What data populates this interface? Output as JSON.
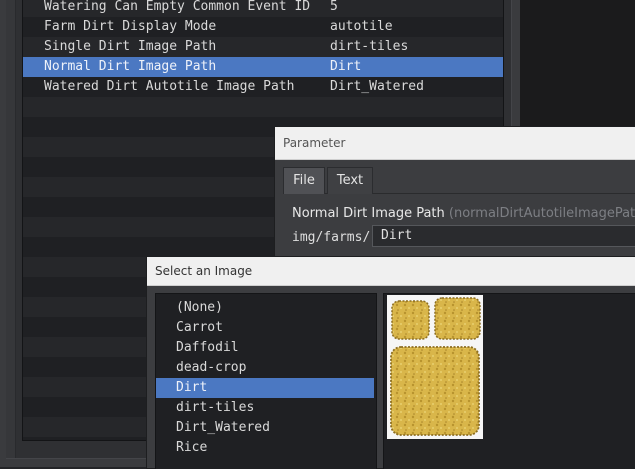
{
  "params": {
    "rows": [
      {
        "key": "Watering Can Empty Common Event ID",
        "value": "5",
        "selected": false
      },
      {
        "key": "Farm Dirt Display Mode",
        "value": "autotile",
        "selected": false
      },
      {
        "key": "Single Dirt Image Path",
        "value": "dirt-tiles",
        "selected": false
      },
      {
        "key": "Normal Dirt Image Path",
        "value": "Dirt",
        "selected": true
      },
      {
        "key": "Watered Dirt Autotile Image Path",
        "value": "Dirt_Watered",
        "selected": false
      }
    ]
  },
  "param_dialog": {
    "title": "Parameter",
    "tabs": [
      "File",
      "Text"
    ],
    "active_tab": "File",
    "param_name": "Normal Dirt Image Path",
    "param_code": "(normalDirtAutotileImagePath)",
    "path_prefix": "img/farms/",
    "path_value": "Dirt"
  },
  "image_dialog": {
    "title": "Select an Image",
    "files": [
      "(None)",
      "Carrot",
      "Daffodil",
      "dead-crop",
      "Dirt",
      "dirt-tiles",
      "Dirt_Watered",
      "Rice"
    ],
    "selected": "Dirt",
    "preview": "dirt-autotile-preview"
  },
  "colors": {
    "selection": "#4b78c2",
    "dirt_fill": "#d9b64a",
    "dirt_edge": "#8c6e22"
  }
}
